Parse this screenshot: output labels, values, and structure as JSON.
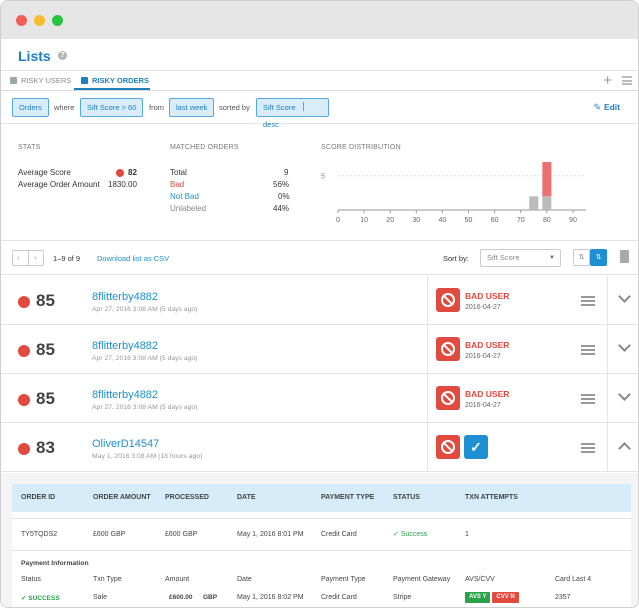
{
  "page": {
    "title": "Lists",
    "help": "?"
  },
  "tabs": [
    {
      "label": "RISKY USERS"
    },
    {
      "label": "RISKY ORDERS"
    }
  ],
  "filter": {
    "entity": "Orders",
    "where": "where",
    "condition": "Sift Score > 60",
    "from": "from",
    "period": "last week",
    "sorted_by": "sorted by",
    "sort_field": "Sift Score",
    "sort_dir": "desc",
    "edit": "Edit"
  },
  "stats": {
    "heading": "STATS",
    "avg_score_label": "Average Score",
    "avg_score": "82",
    "avg_amount_label": "Average Order Amount",
    "avg_amount": "1830.00"
  },
  "matched": {
    "heading": "MATCHED  ORDERS",
    "total_label": "Total",
    "total": "9",
    "bad_label": "Bad",
    "bad": "56%",
    "notbad_label": "Not Bad",
    "notbad": "0%",
    "unlabeled_label": "Unlabeled",
    "unlabeled": "44%"
  },
  "chart_data": {
    "type": "bar",
    "title": "SCORE DISTRIBUTION",
    "xticks": [
      "0",
      "10",
      "20",
      "30",
      "40",
      "50",
      "60",
      "70",
      "80",
      "90"
    ],
    "ytick": "5",
    "series": [
      {
        "name": "Unlabeled",
        "color": "#bbbbbb",
        "x": [
          75,
          80
        ],
        "values": [
          2,
          2
        ]
      },
      {
        "name": "Bad",
        "color": "#ec7070",
        "x": [
          80
        ],
        "values": [
          5
        ]
      }
    ],
    "xlim": [
      0,
      95
    ],
    "ylim": [
      0,
      7
    ]
  },
  "listbar": {
    "range": "1–9 of 9",
    "download": "Download list as CSV",
    "sort_label": "Sort by:",
    "sort_value": "Sift Score"
  },
  "rows": [
    {
      "score": "85",
      "user": "8flitterby4882",
      "date": "Apr 27, 2016 3:08 AM (5 days ago)",
      "label": "BAD USER",
      "label_date": "2016-04-27"
    },
    {
      "score": "85",
      "user": "8flitterby4882",
      "date": "Apr 27, 2016 3:08 AM (5 days ago)",
      "label": "BAD USER",
      "label_date": "2016-04-27"
    },
    {
      "score": "85",
      "user": "8flitterby4882",
      "date": "Apr 27, 2016 3:08 AM (5 days ago)",
      "label": "BAD USER",
      "label_date": "2016-04-27"
    },
    {
      "score": "83",
      "user": "OliverD14547",
      "date": "May 1, 2016 3:08 AM (18 hours ago)"
    }
  ],
  "order_table": {
    "headers": [
      "ORDER ID",
      "ORDER AMOUNT",
      "PROCESSED",
      "DATE",
      "PAYMENT TYPE",
      "STATUS",
      "TXN ATTEMPTS"
    ],
    "row": [
      "TY5TQDS2",
      "£600 GBP",
      "£600 GBP",
      "May 1, 2016 8:01 PM",
      "Credit Card",
      "Success",
      "1"
    ]
  },
  "payment": {
    "heading": "Payment Information",
    "headers": [
      "Status",
      "Txn Type",
      "Amount",
      "Date",
      "Payment Type",
      "Payment Gateway",
      "AVS/CVV",
      "Card Last 4"
    ],
    "row": {
      "status": "SUCCESS",
      "txn_type": "Sale",
      "amount": "£600.00",
      "currency": "GBP",
      "date": "May 1, 2016 8:02 PM",
      "payment_type": "Credit Card",
      "gateway": "Stripe",
      "avs": "AVS Y",
      "cvv": "CVV N",
      "last4": "2357"
    }
  }
}
